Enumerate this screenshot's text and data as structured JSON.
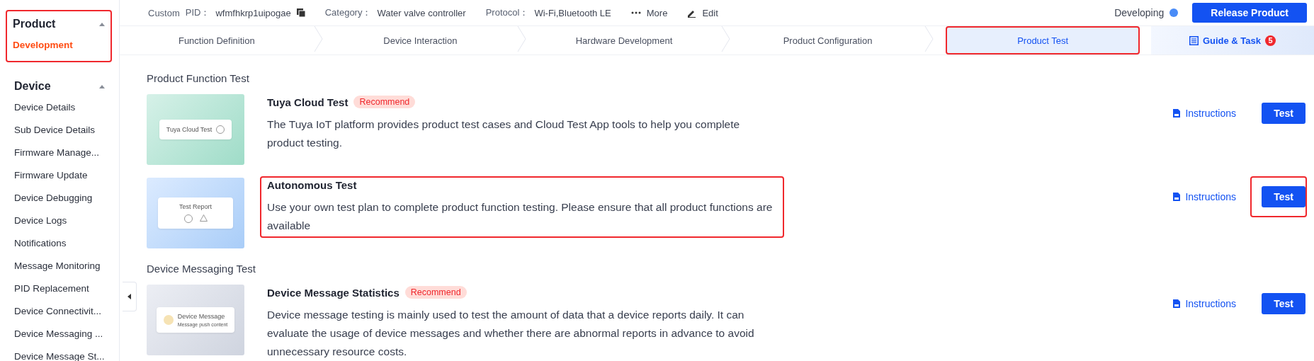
{
  "sidebar": {
    "groups": [
      {
        "title": "Product",
        "expanded": true,
        "highlighted": true,
        "items": [
          {
            "label": "Development",
            "selected": true
          }
        ]
      },
      {
        "title": "Device",
        "expanded": true,
        "highlighted": false,
        "items": [
          {
            "label": "Device Details",
            "selected": false
          },
          {
            "label": "Sub Device Details",
            "selected": false
          },
          {
            "label": "Firmware Manage...",
            "selected": false
          },
          {
            "label": "Firmware Update",
            "selected": false
          },
          {
            "label": "Device Debugging",
            "selected": false
          },
          {
            "label": "Device Logs",
            "selected": false
          },
          {
            "label": "Notifications",
            "selected": false
          },
          {
            "label": "Message Monitoring",
            "selected": false
          },
          {
            "label": "PID Replacement",
            "selected": false
          },
          {
            "label": "Device Connectivit...",
            "selected": false
          },
          {
            "label": "Device Messaging ...",
            "selected": false
          },
          {
            "label": "Device Message St...",
            "selected": false
          }
        ]
      }
    ]
  },
  "header": {
    "type": "Custom",
    "pid_label": "PID：",
    "pid": "wfmfhkrp1uipogae",
    "category_label": "Category：",
    "category": "Water valve controller",
    "protocol_label": "Protocol：",
    "protocol": "Wi-Fi,Bluetooth LE",
    "more": "More",
    "edit": "Edit",
    "status": "Developing",
    "release_button": "Release Product"
  },
  "steps": [
    {
      "label": "Function Definition",
      "selected": false,
      "highlighted": false
    },
    {
      "label": "Device Interaction",
      "selected": false,
      "highlighted": false
    },
    {
      "label": "Hardware Development",
      "selected": false,
      "highlighted": false
    },
    {
      "label": "Product Configuration",
      "selected": false,
      "highlighted": false
    },
    {
      "label": "Product Test",
      "selected": true,
      "highlighted": true
    }
  ],
  "guide": {
    "label": "Guide & Task",
    "badge": "5"
  },
  "sections": [
    {
      "title": "Product Function Test",
      "tests": [
        {
          "kind": "cloud",
          "title": "Tuya Cloud Test",
          "tag": "Recommend",
          "description": "The Tuya IoT platform provides product test cases and Cloud Test App tools to help you complete product testing.",
          "image_texts": [
            "Tuya Cloud Test"
          ],
          "highlighted": false,
          "instructions": "Instructions",
          "button": "Test",
          "button_highlighted": false
        },
        {
          "kind": "report",
          "title": "Autonomous Test",
          "description": "Use your own test plan to complete product function testing. Please ensure that all product functions are available",
          "image_texts": [
            "Test Report"
          ],
          "highlighted": true,
          "instructions": "Instructions",
          "button": "Test",
          "button_highlighted": true
        }
      ]
    },
    {
      "title": "Device Messaging Test",
      "tests": [
        {
          "kind": "message",
          "title": "Device Message Statistics",
          "tag": "Recommend",
          "description": "Device message testing is mainly used to test the amount of data that a device reports daily. It can evaluate the usage of device messages and whether there are abnormal reports in advance to avoid unnecessary resource costs.",
          "image_texts": [
            "Device Message",
            "Message push content"
          ],
          "highlighted": false,
          "instructions": "Instructions",
          "button": "Test",
          "button_highlighted": false
        }
      ]
    }
  ]
}
